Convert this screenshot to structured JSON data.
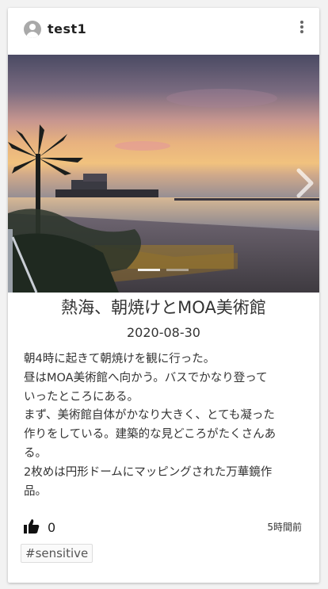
{
  "post": {
    "username": "test1",
    "title": "熱海、朝焼けとMOA美術館",
    "date": "2020-08-30",
    "body_lines": [
      "朝4時に起きて朝焼けを観に行った。",
      "昼はMOA美術館へ向かう。バスでかなり登って",
      "いったところにある。",
      "まず、美術館自体がかなり大きく、とても凝った",
      "作りをしている。建築的な見どころがたくさんあ",
      "る。",
      "2枚めは円形ドームにマッピングされた万華鏡作",
      "品。"
    ],
    "likes": "0",
    "time_ago": "5時間前",
    "tag": "#sensitive"
  },
  "carousel": {
    "slide_count": 2,
    "active_index": 0,
    "image_subject": "sunrise over Atami beach with palm tree"
  },
  "icons": {
    "avatar": "user-avatar-icon",
    "menu": "more-vertical-icon",
    "next": "chevron-right-icon",
    "like": "thumbs-up-icon"
  }
}
